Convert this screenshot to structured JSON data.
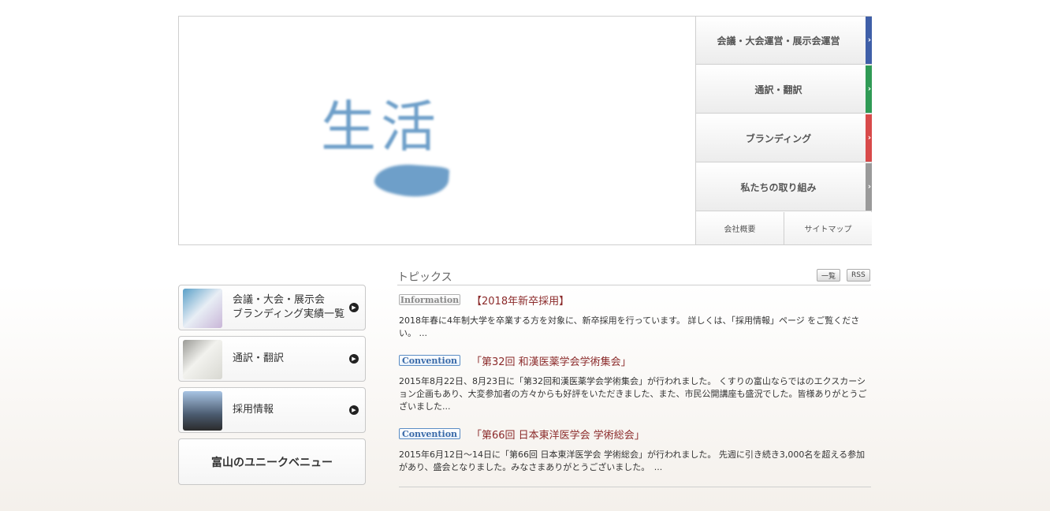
{
  "hero": {
    "kanji": "生活"
  },
  "nav": {
    "items": [
      {
        "label": "会議・大会運営・展示会運営",
        "color": "#3f5fa8"
      },
      {
        "label": "通訳・翻訳",
        "color": "#2f9a55"
      },
      {
        "label": "ブランディング",
        "color": "#d84a4a"
      },
      {
        "label": "私たちの取り組み",
        "color": "#9a9a9a"
      }
    ],
    "arrow": "›",
    "sub": [
      "会社概要",
      "サイトマップ"
    ]
  },
  "side": {
    "items": [
      {
        "label": "会議・大会・展示会\nブランディング実績一覧",
        "icon": "play-icon"
      },
      {
        "label": "通訳・翻訳",
        "icon": "play-icon"
      },
      {
        "label": "採用情報",
        "icon": "play-icon"
      }
    ],
    "unique_label": "富山のユニークベニュー"
  },
  "topics": {
    "title": "トピックス",
    "list_button": "一覧",
    "rss_button": "RSS",
    "items": [
      {
        "badge": "Information",
        "title": "【2018年新卒採用】",
        "body": "2018年春に4年制大学を卒業する方を対象に、新卒採用を行っています。 詳しくは、「採用情報」ページ をご覧ください。 ..."
      },
      {
        "badge": "Convention",
        "title": "「第32回 和漢医薬学会学術集会」",
        "body": "2015年8月22日、8月23日に「第32回和漢医薬学会学術集会」が行われました。 くすりの富山ならではのエクスカーション企画もあり、大変参加者の方々からも好評をいただきました、また、市民公開講座も盛況でした。皆様ありがとうございました..."
      },
      {
        "badge": "Convention",
        "title": "「第66回 日本東洋医学会 学術総会」",
        "body": "2015年6月12日～14日に「第66回 日本東洋医学会 学術総会」が行われました。 先週に引き続き3,000名を超える参加があり、盛会となりました。みなさまありがとうございました。　..."
      }
    ]
  }
}
